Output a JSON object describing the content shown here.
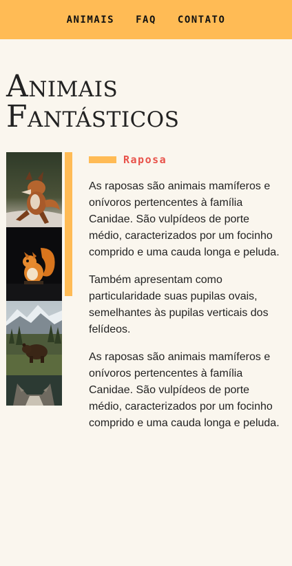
{
  "nav": {
    "items": [
      {
        "label": "ANIMAIS"
      },
      {
        "label": "FAQ"
      },
      {
        "label": "CONTATO"
      }
    ]
  },
  "page": {
    "title": "Animais Fantásticos"
  },
  "gallery": {
    "images": [
      {
        "icon": "fox-photo"
      },
      {
        "icon": "squirrel-photo"
      },
      {
        "icon": "bear-photo"
      },
      {
        "icon": "wolf-photo"
      }
    ]
  },
  "article": {
    "subtitle": "Raposa",
    "paragraphs": [
      "As raposas são animais mamíferos e onívoros pertencentes à família Canidae. São vulpídeos de porte médio, caracterizados por um focinho comprido e uma cauda longa e peluda.",
      "Também apresentam como particularidade suas pupilas ovais, semelhantes às pupilas verticais dos felídeos.",
      "As raposas são animais mamíferos e onívoros pertencentes à família Canidae. São vulpídeos de porte médio, caracterizados por um focinho comprido e uma cauda longa e peluda."
    ]
  },
  "colors": {
    "accent": "#FFBB55",
    "highlight": "#E8524A",
    "background": "#FAF6EE"
  }
}
